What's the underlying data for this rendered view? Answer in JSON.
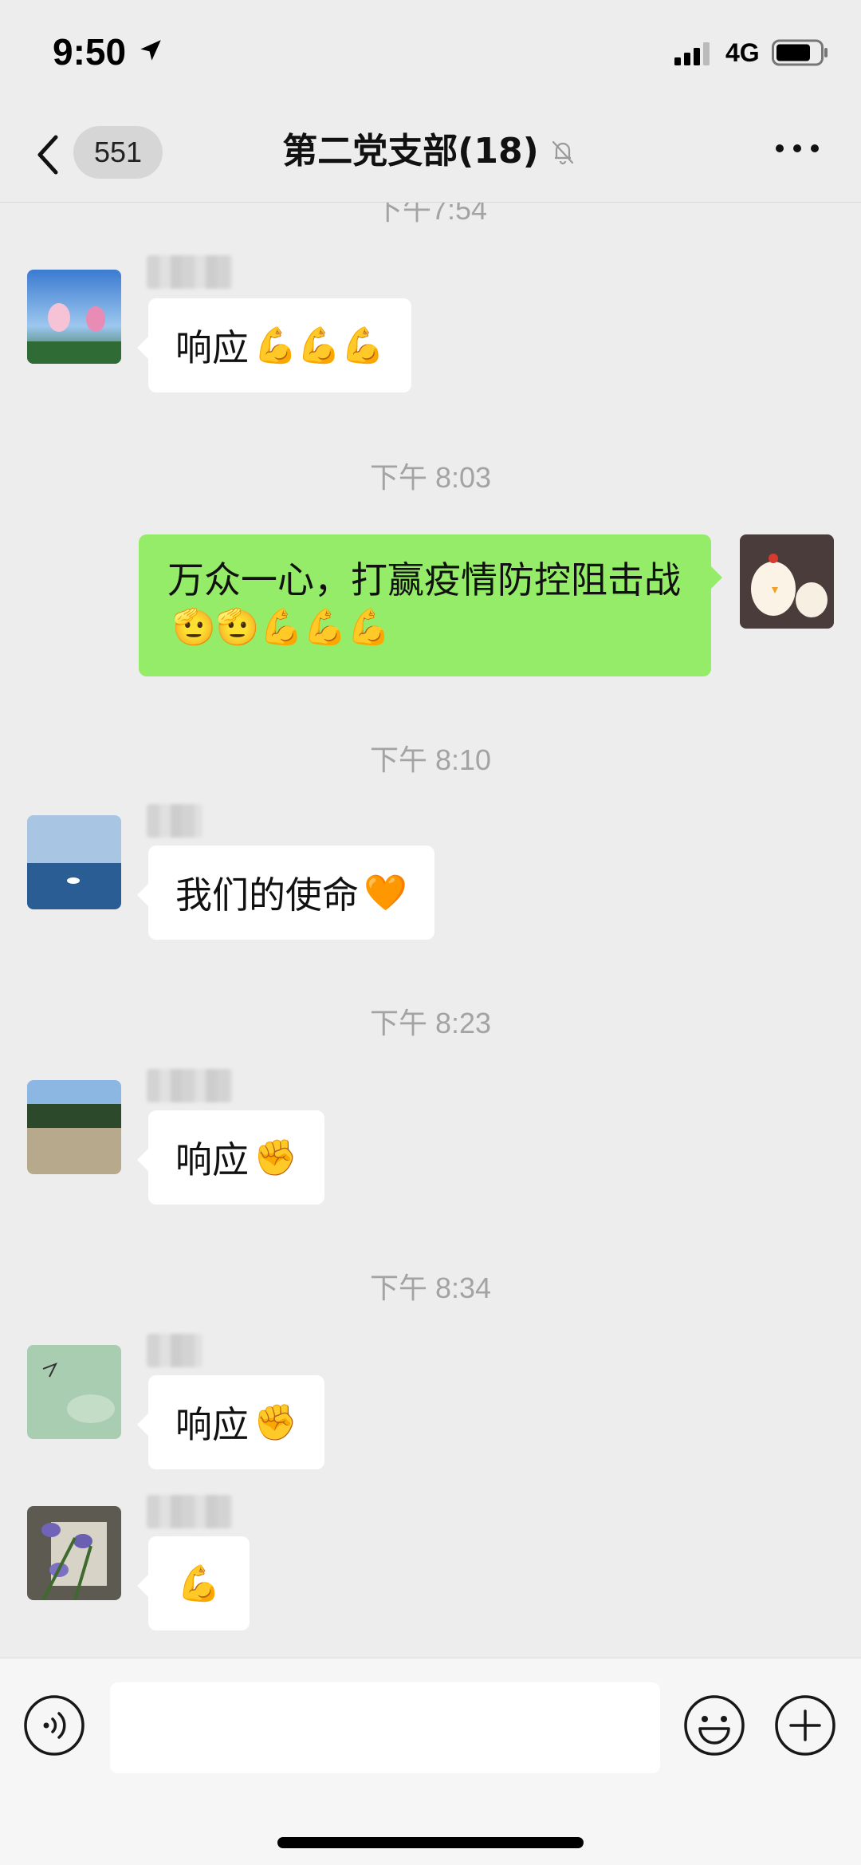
{
  "status_bar": {
    "time": "9:50",
    "network": "4G"
  },
  "nav": {
    "unread_count": "551",
    "title": "第二党支部(18)"
  },
  "timeline": [
    {
      "type": "timestamp",
      "text": "下午7:54"
    },
    {
      "type": "message",
      "side": "left",
      "text": "响应",
      "emoji": "💪💪💪",
      "avatar": "lotus-avatar"
    },
    {
      "type": "timestamp",
      "text": "下午 8:03"
    },
    {
      "type": "message",
      "side": "right",
      "text": "万众一心，打赢疫情防控阻击战",
      "emoji": "🫡🫡💪💪💪",
      "avatar": "chick-avatar"
    },
    {
      "type": "timestamp",
      "text": "下午 8:10"
    },
    {
      "type": "message",
      "side": "left",
      "text": "我们的使命",
      "emoji": "🧡",
      "avatar": "lake-avatar"
    },
    {
      "type": "timestamp",
      "text": "下午 8:23"
    },
    {
      "type": "message",
      "side": "left",
      "text": "响应",
      "emoji": "✊",
      "avatar": "beach-avatar"
    },
    {
      "type": "timestamp",
      "text": "下午 8:34"
    },
    {
      "type": "message",
      "side": "left",
      "text": "响应",
      "emoji": "✊",
      "avatar": "sky-avatar"
    },
    {
      "type": "message",
      "side": "left",
      "text": "",
      "emoji": "💪",
      "avatar": "flower-avatar"
    }
  ],
  "input": {
    "placeholder": ""
  },
  "colors": {
    "background": "#ededed",
    "self_bubble": "#95ec69",
    "other_bubble": "#ffffff",
    "timestamp": "#a3a3a3"
  }
}
